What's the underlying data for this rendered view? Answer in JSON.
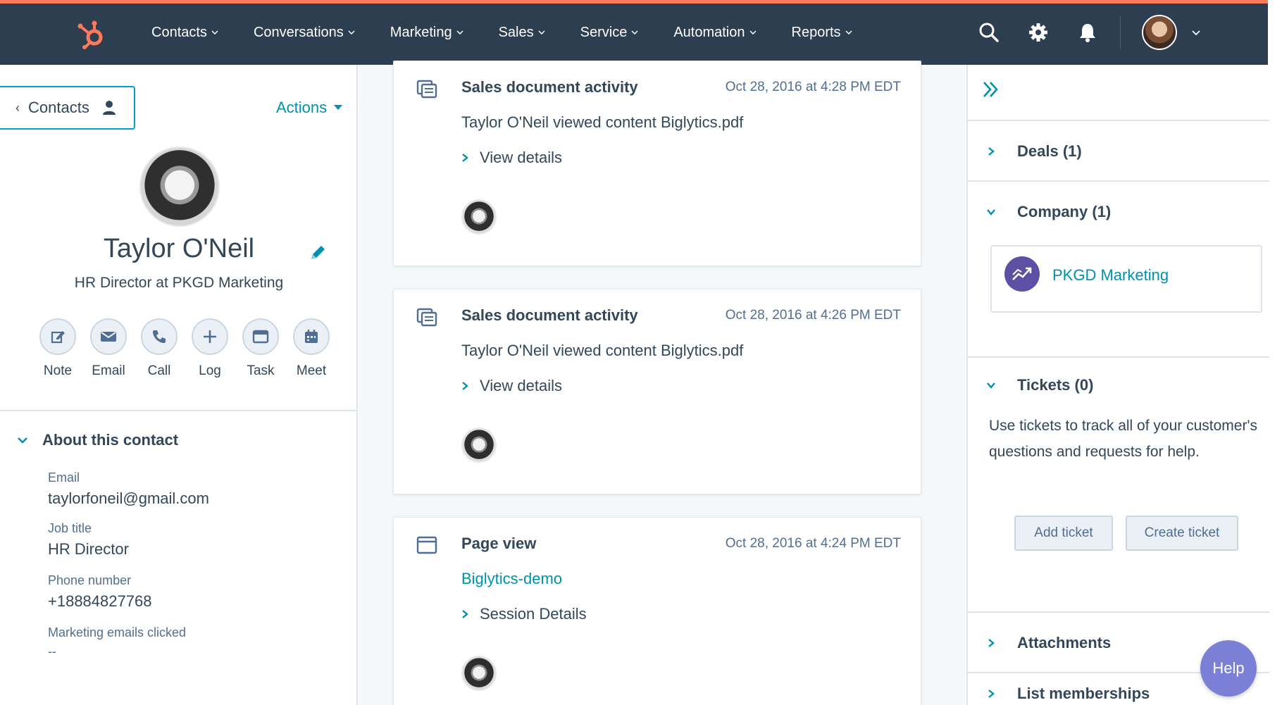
{
  "nav": {
    "items": [
      {
        "label": "Contacts"
      },
      {
        "label": "Conversations"
      },
      {
        "label": "Marketing"
      },
      {
        "label": "Sales"
      },
      {
        "label": "Service"
      },
      {
        "label": "Automation"
      },
      {
        "label": "Reports"
      }
    ],
    "icons": [
      "search-icon",
      "gear-icon",
      "bell-icon"
    ],
    "accent_color": "#ff7a59",
    "bar_color": "#2d3e50"
  },
  "left": {
    "back_label": "Contacts",
    "actions_label": "Actions",
    "name": "Taylor O'Neil",
    "title": "HR Director at PKGD Marketing",
    "quick_actions": [
      {
        "label": "Note",
        "icon": "note-icon"
      },
      {
        "label": "Email",
        "icon": "email-icon"
      },
      {
        "label": "Call",
        "icon": "phone-icon"
      },
      {
        "label": "Log",
        "icon": "plus-icon"
      },
      {
        "label": "Task",
        "icon": "task-icon"
      },
      {
        "label": "Meet",
        "icon": "calendar-icon"
      }
    ],
    "about_heading": "About this contact",
    "properties": [
      {
        "label": "Email",
        "value": "taylorfoneil@gmail.com"
      },
      {
        "label": "Job title",
        "value": "HR Director"
      },
      {
        "label": "Phone number",
        "value": "+18884827768"
      },
      {
        "label": "Marketing emails clicked",
        "value": "--"
      }
    ]
  },
  "timeline": [
    {
      "type_icon": "document-icon",
      "title": "Sales document activity",
      "date": "Oct 28, 2016 at 4:28 PM EDT",
      "body": "Taylor O'Neil viewed content Biglytics.pdf",
      "details": "View details"
    },
    {
      "type_icon": "document-icon",
      "title": "Sales document activity",
      "date": "Oct 28, 2016 at 4:26 PM EDT",
      "body": "Taylor O'Neil viewed content Biglytics.pdf",
      "details": "View details"
    },
    {
      "type_icon": "browser-icon",
      "title": "Page view",
      "date": "Oct 28, 2016 at 4:24 PM EDT",
      "link": "Biglytics-demo",
      "details": "Session Details"
    }
  ],
  "right": {
    "deals": "Deals (1)",
    "company": "Company (1)",
    "company_name": "PKGD Marketing",
    "tickets": "Tickets (0)",
    "tickets_text": "Use tickets to track all of your customer's questions and requests for help.",
    "add_ticket": "Add ticket",
    "create_ticket": "Create ticket",
    "attachments": "Attachments",
    "list_memberships": "List memberships"
  },
  "help_label": "Help"
}
